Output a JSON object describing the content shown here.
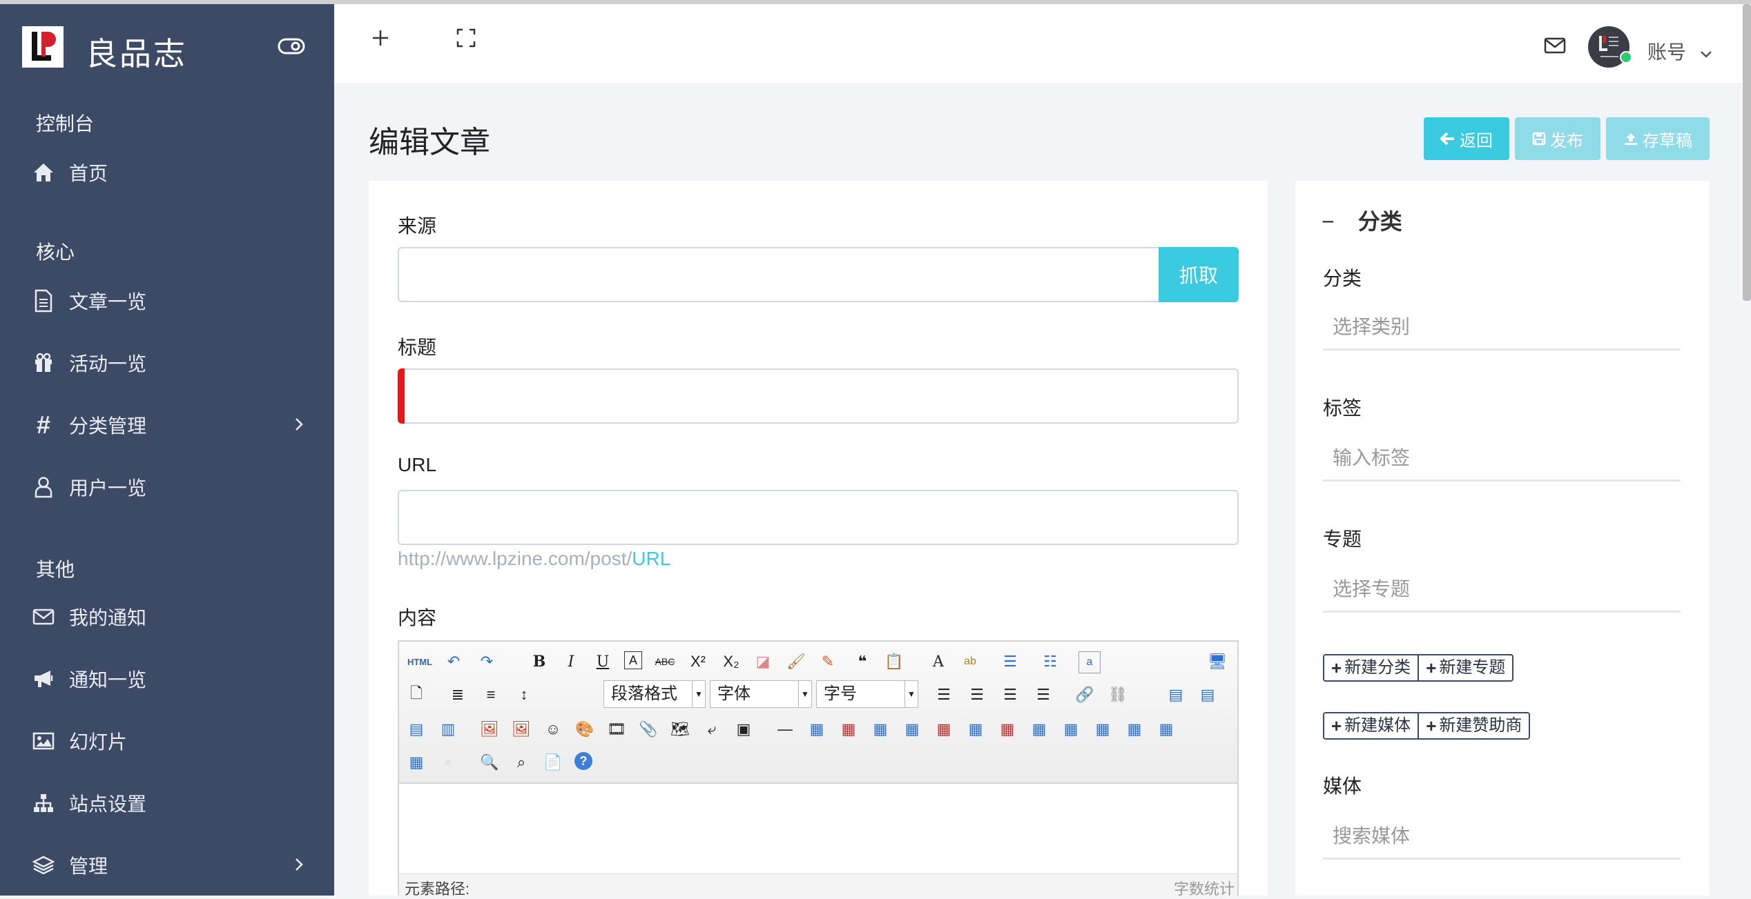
{
  "sidebar": {
    "brand": "良品志",
    "sections": {
      "console": "控制台",
      "core": "核心",
      "other": "其他"
    },
    "items": [
      {
        "label": "首页"
      },
      {
        "label": "文章一览"
      },
      {
        "label": "活动一览"
      },
      {
        "label": "分类管理"
      },
      {
        "label": "用户一览"
      },
      {
        "label": "我的通知"
      },
      {
        "label": "通知一览"
      },
      {
        "label": "幻灯片"
      },
      {
        "label": "站点设置"
      },
      {
        "label": "管理"
      }
    ]
  },
  "header": {
    "account_label": "账号"
  },
  "page": {
    "title": "编辑文章",
    "buttons": {
      "back": "返回",
      "publish": "发布",
      "save_draft": "存草稿"
    }
  },
  "form": {
    "source_label": "来源",
    "fetch_button": "抓取",
    "title_label": "标题",
    "url_label": "URL",
    "url_hint_prefix": "http://www.lpzine.com/post/",
    "url_hint_suffix": "URL",
    "content_label": "内容"
  },
  "editor": {
    "html_button": "HTML",
    "paragraph_select": "段落格式",
    "font_select": "字体",
    "size_select": "字号",
    "path_label": "元素路径:",
    "word_count": "字数统计"
  },
  "right_panel": {
    "section_title": "分类",
    "collapse_symbol": "−",
    "category_label": "分类",
    "category_placeholder": "选择类别",
    "tag_label": "标签",
    "tag_placeholder": "输入标签",
    "topic_label": "专题",
    "topic_placeholder": "选择专题",
    "new_category": "新建分类",
    "new_topic": "新建专题",
    "new_media": "新建媒体",
    "new_sponsor": "新建赞助商",
    "media_label": "媒体",
    "media_placeholder": "搜索媒体"
  },
  "colors": {
    "sidebar_bg": "#3c4a66",
    "accent": "#3bcbe0",
    "accent_light": "#8fdbe8",
    "required_marker": "#e81818",
    "online": "#2ecc71"
  }
}
